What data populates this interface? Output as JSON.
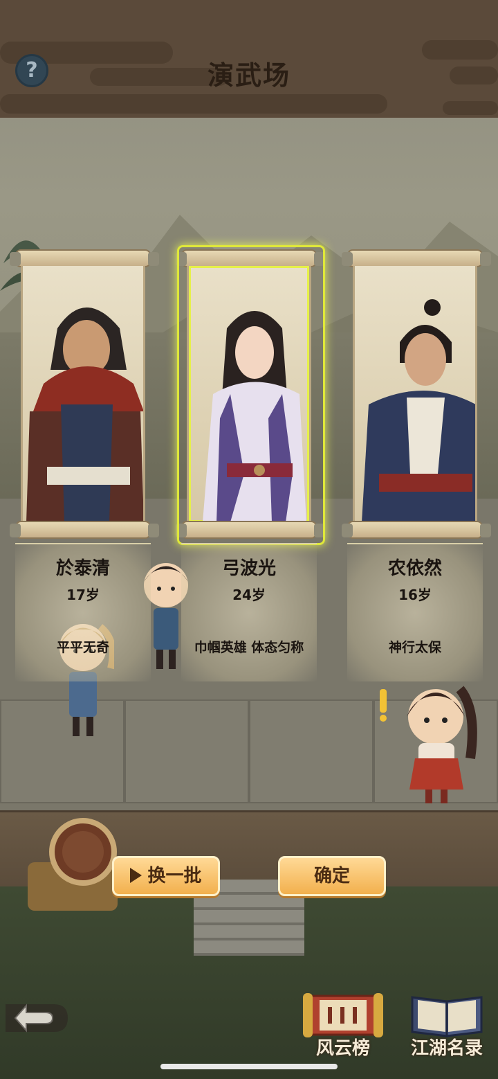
{
  "header": {
    "title": "演武场"
  },
  "candidates": [
    {
      "name": "於泰清",
      "age": "17岁",
      "traits": "平平无奇",
      "selected": false
    },
    {
      "name": "弓波光",
      "age": "24岁",
      "traits": "巾帼英雄 体态匀称",
      "selected": true
    },
    {
      "name": "农依然",
      "age": "16岁",
      "traits": "神行太保",
      "selected": false
    }
  ],
  "actions": {
    "refresh_label": "换一批",
    "confirm_label": "确定"
  },
  "bottom_nav": {
    "rankings_label": "风云榜",
    "roster_label": "江湖名录"
  },
  "icons": [
    "help-icon",
    "back-arrow-icon",
    "play-icon",
    "rankings-scroll-icon",
    "roster-book-icon",
    "exclamation-icon"
  ],
  "colors": {
    "button_fill": "#f2b04d",
    "selected_glow": "#dfe83a",
    "header_bg": "#5b4a3a"
  }
}
